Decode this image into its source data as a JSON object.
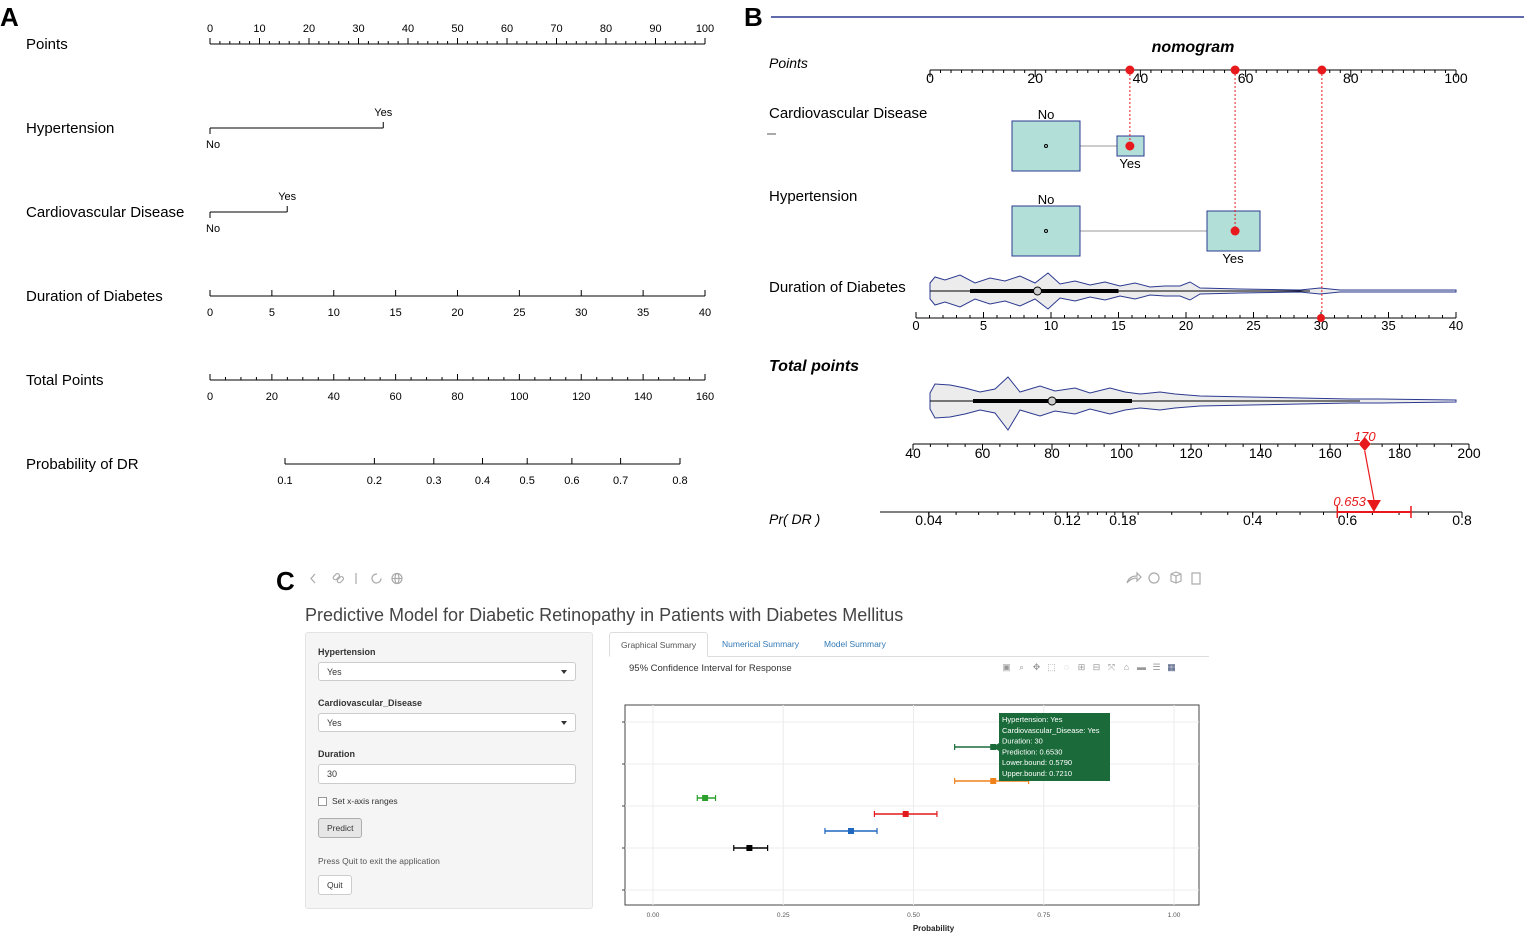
{
  "panel_labels": {
    "a": "A",
    "b": "B",
    "c": "C"
  },
  "colors": {
    "axis": "#000000",
    "navy": "#2b3990",
    "red": "#e8191c",
    "box_fill": "#b3dfd9",
    "violin_fill": "#ececec",
    "tooltip_bg": "#1b6b3a",
    "series": [
      "#1b6b3a",
      "#f0821e",
      "#2ca02c",
      "#e31a1c",
      "#1f67c0",
      "#000000"
    ]
  },
  "chart_data": [
    {
      "type": "nomogram",
      "panel": "A",
      "rows": [
        {
          "label": "Points",
          "kind": "scale",
          "ticks": [
            "0",
            "10",
            "20",
            "30",
            "40",
            "50",
            "60",
            "70",
            "80",
            "90",
            "100"
          ],
          "range": [
            0,
            100
          ]
        },
        {
          "label": "Hypertension",
          "kind": "categorical",
          "levels": [
            {
              "name": "No",
              "points": 0
            },
            {
              "name": "Yes",
              "points": 35
            }
          ]
        },
        {
          "label": "Cardiovascular Disease",
          "kind": "categorical",
          "levels": [
            {
              "name": "No",
              "points": 0
            },
            {
              "name": "Yes",
              "points": 15.6
            }
          ]
        },
        {
          "label": "Duration of Diabetes",
          "kind": "scale",
          "ticks": [
            "0",
            "5",
            "10",
            "15",
            "20",
            "25",
            "30",
            "35",
            "40"
          ],
          "range": [
            0,
            40
          ]
        },
        {
          "label": "Total Points",
          "kind": "scale",
          "ticks": [
            "0",
            "20",
            "40",
            "60",
            "80",
            "100",
            "120",
            "140",
            "160"
          ],
          "range": [
            0,
            160
          ]
        },
        {
          "label": "Probability of DR",
          "kind": "scale",
          "ticks": [
            "0.1",
            "0.2",
            "0.3",
            "0.4",
            "0.5",
            "0.6",
            "0.7",
            "0.8"
          ]
        }
      ]
    },
    {
      "type": "nomogram",
      "panel": "B",
      "title": "nomogram",
      "rows": [
        {
          "label": "Points",
          "ticks": [
            "0",
            "20",
            "40",
            "60",
            "80",
            "100"
          ],
          "range": [
            0,
            100
          ],
          "marked_points": [
            38,
            58,
            74.5
          ]
        },
        {
          "label": "Cardiovascular Disease",
          "levels": [
            {
              "name": "No",
              "points": 16
            },
            {
              "name": "Yes",
              "points": 38
            }
          ],
          "selected": "Yes"
        },
        {
          "label": "Hypertension",
          "levels": [
            {
              "name": "No",
              "points": 16
            },
            {
              "name": "Yes",
              "points": 58
            }
          ],
          "selected": "Yes"
        },
        {
          "label": "Duration of Diabetes",
          "ticks": [
            "0",
            "5",
            "10",
            "15",
            "20",
            "25",
            "30",
            "35",
            "40"
          ],
          "range": [
            0,
            40
          ],
          "selected": 30
        },
        {
          "label": "Total points",
          "ticks": [
            "40",
            "60",
            "80",
            "100",
            "120",
            "140",
            "160",
            "180",
            "200"
          ],
          "range": [
            40,
            200
          ],
          "selected": 170,
          "selected_label": "170"
        },
        {
          "label": "Pr( DR )",
          "ticks": [
            "0.04",
            "0.12",
            "0.18",
            "0.4",
            "0.6",
            "0.8"
          ],
          "selected": 0.653,
          "selected_label": "0.653",
          "ci": [
            0.579,
            0.721
          ]
        }
      ]
    },
    {
      "type": "scatter",
      "panel": "C",
      "title": "95% Confidence Interval for Response",
      "xlabel": "Probability",
      "xlim": [
        0,
        1
      ],
      "xticks": [
        "0.00",
        "0.25",
        "0.50",
        "0.75",
        "1.00"
      ],
      "points": [
        {
          "y": 1,
          "value": 0.653,
          "lower": 0.579,
          "upper": 0.721
        },
        {
          "y": 2,
          "value": 0.653,
          "lower": 0.579,
          "upper": 0.721
        },
        {
          "y": 3,
          "value": 0.1,
          "lower": 0.085,
          "upper": 0.12
        },
        {
          "y": 4,
          "value": 0.485,
          "lower": 0.425,
          "upper": 0.545
        },
        {
          "y": 5,
          "value": 0.38,
          "lower": 0.33,
          "upper": 0.43
        },
        {
          "y": 6,
          "value": 0.185,
          "lower": 0.155,
          "upper": 0.22
        }
      ],
      "tooltip": [
        "Hypertension: Yes",
        "Cardiovascular_Disease: Yes",
        "Duration: 30",
        "Prediction: 0.6530",
        "Lower.bound: 0.5790",
        "Upper.bound: 0.7210"
      ]
    }
  ],
  "app": {
    "title": "Predictive Model for Diabetic Retinopathy in Patients with Diabetes Mellitus",
    "hypertension_label": "Hypertension",
    "hypertension_value": "Yes",
    "cvd_label": "Cardiovascular_Disease",
    "cvd_value": "Yes",
    "duration_label": "Duration",
    "duration_value": "30",
    "xrange_checkbox": "Set x-axis ranges",
    "predict_button": "Predict",
    "quit_note": "Press Quit to exit the application",
    "quit_button": "Quit",
    "tabs": [
      "Graphical Summary",
      "Numerical Summary",
      "Model Summary"
    ]
  }
}
